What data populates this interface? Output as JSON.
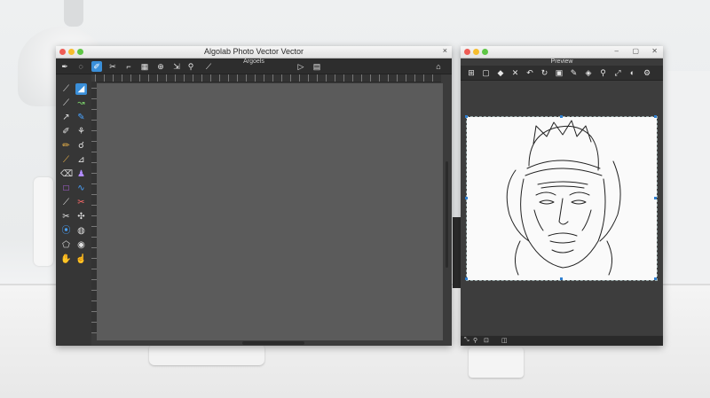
{
  "main_window": {
    "title": "Algolab Photo Vector Vector",
    "subtitle": "Argoels",
    "close_glyph": "×",
    "toolbar_icons": [
      {
        "name": "pen-icon",
        "glyph": "✒"
      },
      {
        "name": "lasso-icon",
        "glyph": "◌"
      },
      {
        "name": "brush-icon",
        "glyph": "✐"
      },
      {
        "name": "scissors-icon",
        "glyph": "✂"
      },
      {
        "name": "crop-icon",
        "glyph": "⌐"
      },
      {
        "name": "grid-icon",
        "glyph": "▦"
      },
      {
        "name": "zoom-icon",
        "glyph": "⊕"
      },
      {
        "name": "transform-icon",
        "glyph": "⇲"
      },
      {
        "name": "search-icon",
        "glyph": "⚲"
      },
      {
        "name": "line-icon",
        "glyph": "⟋"
      },
      {
        "name": "play-icon",
        "glyph": "▷"
      },
      {
        "name": "layers-icon",
        "glyph": "▤"
      },
      {
        "name": "home-icon",
        "glyph": "⌂"
      }
    ],
    "tools": [
      {
        "name": "line-tool-icon",
        "glyph": "⟋",
        "color": "#d8d8d8"
      },
      {
        "name": "fill-tool-icon",
        "glyph": "◢",
        "color": "#4aa3ff"
      },
      {
        "name": "pen-tool-icon",
        "glyph": "⟋",
        "color": "#e0e0e0"
      },
      {
        "name": "path-tool-icon",
        "glyph": "↝",
        "color": "#7bd36a"
      },
      {
        "name": "arrow-tool-icon",
        "glyph": "↗",
        "color": "#e0e0e0"
      },
      {
        "name": "marker-tool-icon",
        "glyph": "✎",
        "color": "#4aa3ff"
      },
      {
        "name": "brush-tool-icon",
        "glyph": "✐",
        "color": "#e0e0e0"
      },
      {
        "name": "stamp-tool-icon",
        "glyph": "⚘",
        "color": "#e0e0e0"
      },
      {
        "name": "pencil-tool-icon",
        "glyph": "✏",
        "color": "#f2b84a"
      },
      {
        "name": "smudge-tool-icon",
        "glyph": "☌",
        "color": "#e0e0e0"
      },
      {
        "name": "nib-tool-icon",
        "glyph": "⟋",
        "color": "#f2b84a"
      },
      {
        "name": "dropper-tool-icon",
        "glyph": "⊿",
        "color": "#e0e0e0"
      },
      {
        "name": "eraser-tool-icon",
        "glyph": "⌫",
        "color": "#e0e0e0"
      },
      {
        "name": "person-tool-icon",
        "glyph": "♟",
        "color": "#b18cff"
      },
      {
        "name": "shape-tool-icon",
        "glyph": "□",
        "color": "#c86bff"
      },
      {
        "name": "curve-tool-icon",
        "glyph": "∿",
        "color": "#4aa3ff"
      },
      {
        "name": "knife-tool-icon",
        "glyph": "⟋",
        "color": "#e0e0e0"
      },
      {
        "name": "scissors-tool-icon",
        "glyph": "✂",
        "color": "#ff6b6b"
      },
      {
        "name": "cut-tool-icon",
        "glyph": "✂",
        "color": "#e0e0e0"
      },
      {
        "name": "sparkle-tool-icon",
        "glyph": "✣",
        "color": "#e0e0e0"
      },
      {
        "name": "picker-tool-icon",
        "glyph": "⦿",
        "color": "#4aa3ff"
      },
      {
        "name": "bucket-tool-icon",
        "glyph": "◍",
        "color": "#e0e0e0"
      },
      {
        "name": "polygon-tool-icon",
        "glyph": "⬠",
        "color": "#e0e0e0"
      },
      {
        "name": "target-tool-icon",
        "glyph": "◉",
        "color": "#e0e0e0"
      },
      {
        "name": "hand-tool-icon",
        "glyph": "✋",
        "color": "#e0e0e0"
      },
      {
        "name": "finger-tool-icon",
        "glyph": "☝",
        "color": "#e0e0e0"
      }
    ]
  },
  "preview_window": {
    "title": "Preview",
    "toolbar_icons": [
      {
        "name": "layers-icon",
        "glyph": "⊞"
      },
      {
        "name": "frame-icon",
        "glyph": "▢"
      },
      {
        "name": "fill-icon",
        "glyph": "◆"
      },
      {
        "name": "cross-icon",
        "glyph": "✕"
      },
      {
        "name": "undo-icon",
        "glyph": "↶"
      },
      {
        "name": "rotate-icon",
        "glyph": "↻"
      },
      {
        "name": "image-icon",
        "glyph": "▣"
      },
      {
        "name": "pen-icon",
        "glyph": "✎"
      },
      {
        "name": "sample-icon",
        "glyph": "◈"
      },
      {
        "name": "search-icon",
        "glyph": "⚲"
      },
      {
        "name": "fit-icon",
        "glyph": "⤢"
      },
      {
        "name": "compare-icon",
        "glyph": "◐"
      },
      {
        "name": "settings-icon",
        "glyph": "⚙"
      }
    ],
    "status_icons": [
      {
        "name": "expand-icon",
        "glyph": "⤡"
      },
      {
        "name": "zoom-icon",
        "glyph": "⚲"
      },
      {
        "name": "fit-icon",
        "glyph": "⊡"
      },
      {
        "name": "scale-icon",
        "glyph": "◫"
      }
    ],
    "window_controls": [
      "–",
      "▢",
      "✕"
    ]
  },
  "colors": {
    "accent": "#3a8fd9",
    "window_bg": "#3b3b3b",
    "canvas_bg": "#5b5b5b"
  }
}
